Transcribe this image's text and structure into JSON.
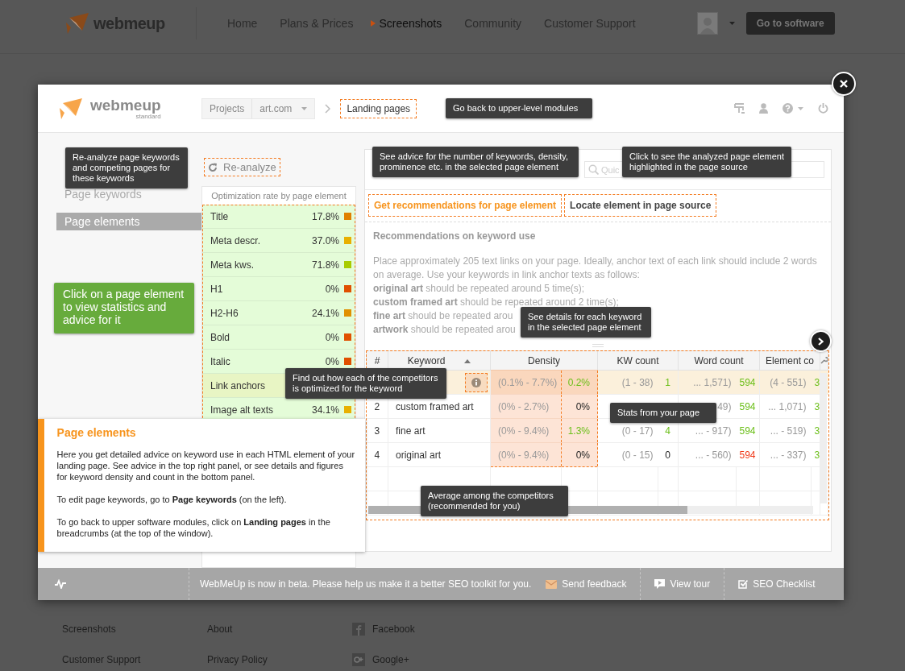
{
  "site_header": {
    "logo": "webmeup",
    "nav": [
      {
        "label": "Home",
        "selected": false
      },
      {
        "label": "Plans & Prices",
        "selected": false
      },
      {
        "label": "Screenshots",
        "selected": true
      },
      {
        "label": "Community",
        "selected": false
      },
      {
        "label": "Customer Support",
        "selected": false
      }
    ],
    "cta": "Go to software"
  },
  "modal": {
    "header": {
      "logo": "webmeup",
      "logo_sub": "standard",
      "breadcrumbs": [
        {
          "label": "Projects",
          "kind": "plain"
        },
        {
          "label": "art.com",
          "kind": "dropdown"
        },
        {
          "label": "Landing pages",
          "kind": "current"
        }
      ]
    },
    "sidebar": {
      "items": [
        {
          "label": "Page keywords",
          "selected": false
        },
        {
          "label": "Page elements",
          "selected": true
        }
      ]
    },
    "reanalyze_button": "Re-analyze",
    "optimization": {
      "heading": "Optimization rate by page element",
      "rows": [
        {
          "label": "Title",
          "value": "17.8%",
          "color": "#e08000",
          "selected": false
        },
        {
          "label": "Meta descr.",
          "value": "37.0%",
          "color": "#e8b000",
          "selected": false
        },
        {
          "label": "Meta kws.",
          "value": "71.8%",
          "color": "#a8cc00",
          "selected": false
        },
        {
          "label": "H1",
          "value": "0%",
          "color": "#e05000",
          "selected": false
        },
        {
          "label": "H2-H6",
          "value": "24.1%",
          "color": "#e09000",
          "selected": false
        },
        {
          "label": "Bold",
          "value": "0%",
          "color": "#e05000",
          "selected": false
        },
        {
          "label": "Italic",
          "value": "0%",
          "color": "#e05000",
          "selected": false
        },
        {
          "label": "Link anchors",
          "selected": true
        },
        {
          "label": "Image alt texts",
          "value": "34.1%",
          "color": "#e8b000",
          "selected": false
        }
      ]
    },
    "search": {
      "placeholder": "Quic"
    },
    "tabs": [
      {
        "label": "Get recommendations for page element",
        "selected": true
      },
      {
        "label": "Locate element in page source",
        "selected": false
      }
    ],
    "recommendations": {
      "title": "Recommendations on keyword use",
      "paragraph": "Place approximately 205 text links on your page. Ideally, anchor text of each link should include 2 words on average. Use your keywords in link anchor texts as follows:",
      "lines": [
        "**original art** should be repeated around 5 time(s);",
        "**custom framed art** should be repeated around 2 time(s);",
        "**fine art** should be repeated arou",
        "**artwork** should be repeated arou"
      ]
    },
    "table": {
      "columns": [
        {
          "label": "#",
          "kind": "text"
        },
        {
          "label": "Keyword",
          "kind": "text",
          "sorted": true
        },
        {
          "label": "Density",
          "kind": "range_value",
          "highlighted": true
        },
        {
          "label": "KW count",
          "kind": "range_value"
        },
        {
          "label": "Word count",
          "kind": "range_value"
        },
        {
          "label": "Element co",
          "kind": "range_value"
        }
      ],
      "rows": [
        {
          "selected": true,
          "density": {
            "range": "(0.1% - 7.7%)",
            "value": "0.2%",
            "color": "#6cbf1a"
          },
          "kw_count": {
            "range": "(1 - 38)",
            "value": "1",
            "color": "#6cbf1a"
          },
          "word_count": {
            "range": "... 1,571)",
            "value": "594",
            "color": "#6cbf1a"
          },
          "element_count": {
            "range": "(4 - 551)",
            "value": "3",
            "color": "#6cbf1a"
          }
        },
        {
          "selected": false,
          "number": "2",
          "keyword": "custom framed art",
          "density": {
            "range": "(0% - 2.7%)",
            "value": "0%"
          },
          "word_count": {
            "range": "49)",
            "value": "594",
            "color": "#6cbf1a"
          },
          "element_count": {
            "range": "... 1,071)",
            "value": "3",
            "color": "#6cbf1a"
          }
        },
        {
          "selected": false,
          "number": "3",
          "keyword": "fine art",
          "density": {
            "range": "(0% - 9.4%)",
            "value": "1.3%",
            "color": "#6cbf1a"
          },
          "kw_count": {
            "range": "(0 - 17)",
            "value": "4",
            "color": "#6cbf1a"
          },
          "word_count": {
            "range": "... - 917)",
            "value": "594",
            "color": "#6cbf1a"
          },
          "element_count": {
            "range": "... - 519)",
            "value": "3",
            "color": "#6cbf1a"
          }
        },
        {
          "selected": false,
          "number": "4",
          "keyword": "original art",
          "density": {
            "range": "(0% - 9.4%)",
            "value": "0%"
          },
          "kw_count": {
            "range": "(0 - 15)",
            "value": "0"
          },
          "word_count": {
            "range": "... - 560)",
            "value": "594",
            "color": "#f03a1a"
          },
          "element_count": {
            "range": "... - 337)",
            "value": "3",
            "color": "#6cbf1a"
          }
        }
      ]
    },
    "status_bar": {
      "message": "WebMeUp is now in beta. Please help us make it a better SEO toolkit for you.",
      "links": [
        {
          "label": "Send feedback",
          "kind": "feedback"
        },
        {
          "label": "View tour",
          "kind": "tour"
        },
        {
          "label": "SEO Checklist",
          "kind": "checklist"
        }
      ]
    }
  },
  "info_card": {
    "title": "Page elements",
    "paragraphs": [
      "Here you get detailed advice on keyword use in each HTML element of your landing page. See advice in the top right panel, or see details and figures for keyword density and count in the bottom panel.",
      "To edit page keywords, go to **Page keywords** (on the left).",
      "To go back to upper software modules, click on **Landing pages** in the breadcrumbs (at the top of the window)."
    ]
  },
  "tooltips": [
    {
      "text": "Go back to upper-level modules",
      "kind": "dark"
    },
    {
      "text": "Re-analyze page keywords and competing pages for these keywords",
      "kind": "dark"
    },
    {
      "text": "Click on a page element to view statistics and advice for it",
      "kind": "green"
    },
    {
      "text": "See advice for the number of keywords, density, prominence etc. in the selected page element",
      "kind": "dark"
    },
    {
      "text": "Click to see the analyzed page element highlighted in the page source",
      "kind": "dark"
    },
    {
      "text": "See details for each keyword in the selected page element",
      "kind": "dark"
    },
    {
      "text": "Find out how each of the competitors is optimized for the keyword",
      "kind": "dark"
    },
    {
      "text": "Stats from your page",
      "kind": "dark"
    },
    {
      "text": "Average among the competitors (recommended for you)",
      "kind": "dark"
    }
  ],
  "footer": {
    "columns": [
      {
        "links": [
          "Screenshots",
          "Customer Support"
        ]
      },
      {
        "links": [
          "About",
          "Privacy Policy"
        ]
      },
      {
        "links": [
          {
            "label": "Facebook",
            "kind": "facebook"
          },
          {
            "label": "Google+",
            "kind": "googleplus"
          }
        ]
      }
    ]
  }
}
